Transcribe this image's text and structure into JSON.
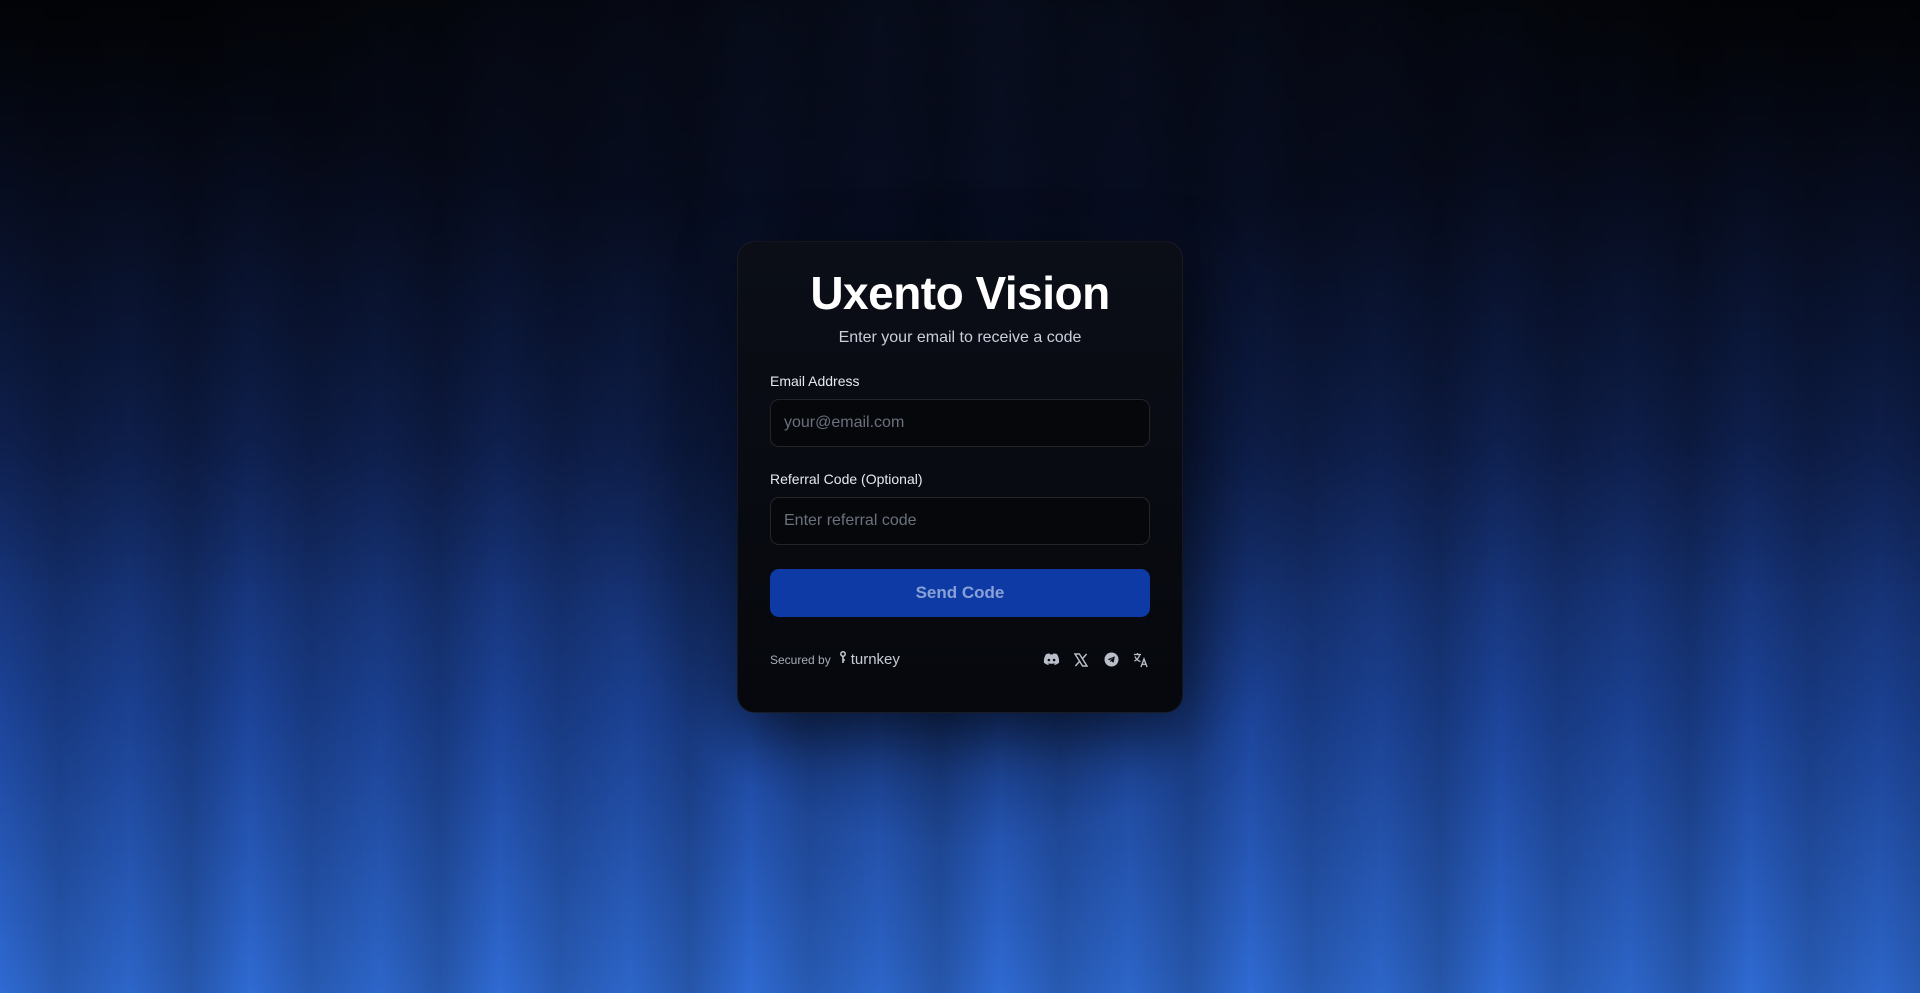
{
  "card": {
    "title": "Uxento Vision",
    "subtitle": "Enter your email to receive a code"
  },
  "email": {
    "label": "Email Address",
    "placeholder": "your@email.com",
    "value": ""
  },
  "referral": {
    "label": "Referral Code (Optional)",
    "placeholder": "Enter referral code",
    "value": ""
  },
  "send_button": {
    "label": "Send Code"
  },
  "footer": {
    "secured_label": "Secured by",
    "brand": "turnkey",
    "social_icons": [
      "discord-icon",
      "x-icon",
      "telegram-icon",
      "translate-icon"
    ]
  },
  "colors": {
    "button": "#0d3aa5",
    "button_text": "#8aa1d6",
    "card": "#080b12",
    "background_bottom": "#2f6bd4"
  }
}
